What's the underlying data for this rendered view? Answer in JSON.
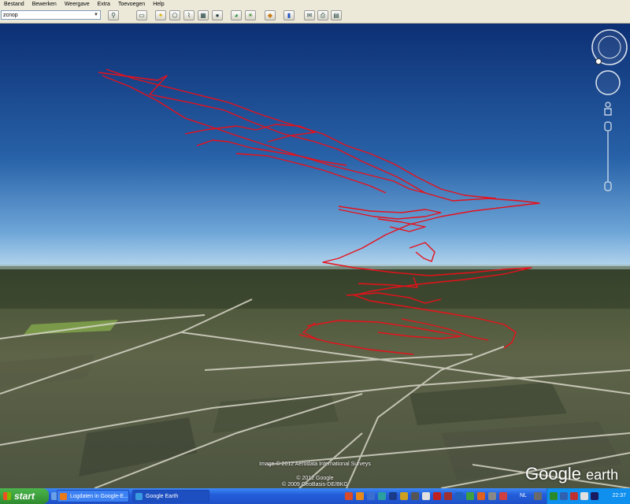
{
  "menu": [
    "Bestand",
    "Bewerken",
    "Weergave",
    "Extra",
    "Toevoegen",
    "Help"
  ],
  "search": {
    "value": "zcnop"
  },
  "view": {
    "credits": [
      "Image © 2012 Aerodata International Surveys",
      "© 2012 Google",
      "© 2009 GeoBasis-DE/BKG"
    ],
    "logo_main": "Google",
    "logo_sub": "earth",
    "track_color": "#e8101a"
  },
  "taskbar": {
    "start_label": "start",
    "items": [
      "Logdaten in Google-E...",
      "Google Earth"
    ],
    "language": "NL",
    "time": "22:37"
  }
}
